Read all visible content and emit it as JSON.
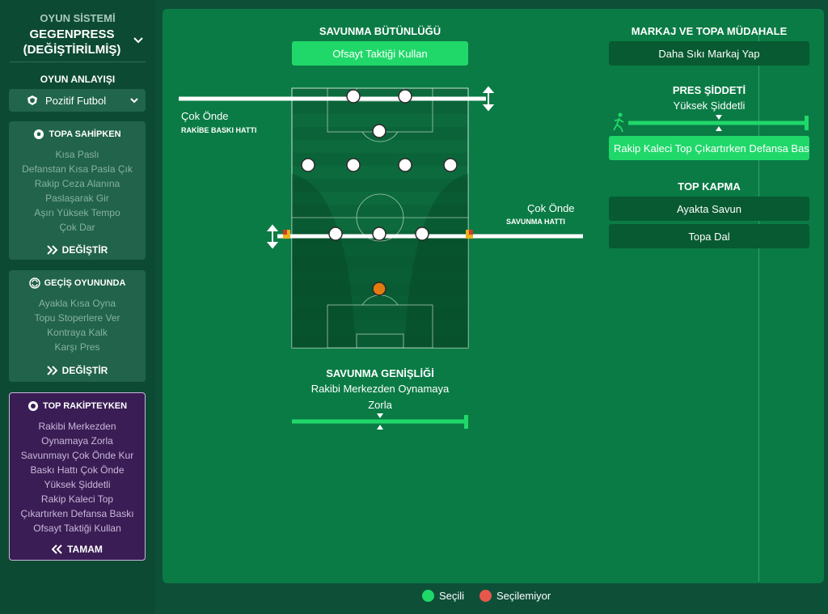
{
  "colors": {
    "accent_green": "#20d86a",
    "unavailable_red": "#e8574b",
    "ball_orange": "#e07b10",
    "purple_card": "#3a1d55",
    "line_yellow": "#e9b21a"
  },
  "system": {
    "label": "OYUN SİSTEMİ",
    "name_line1": "GEGENPRESS",
    "name_line2": "(DEĞİŞTİRİLMİŞ)"
  },
  "mentality": {
    "label": "OYUN ANLAYIŞI",
    "value": "Pozitif Futbol",
    "icon": "shield-icon"
  },
  "in_possession": {
    "title": "TOPA SAHİPKEN",
    "icon": "ball-icon",
    "items": [
      "Kısa Paslı",
      "Defanstan Kısa Pasla Çık",
      "Rakip Ceza Alanına",
      "Paslaşarak Gir",
      "Aşırı Yüksek Tempo",
      "Çok Dar"
    ],
    "action": "DEĞİŞTİR"
  },
  "transition": {
    "title": "GEÇİŞ OYUNUNDA",
    "icon": "cycle-icon",
    "items": [
      "Ayakla Kısa Oyna",
      "Topu Stoperlere Ver",
      "Kontraya Kalk",
      "Karşı Pres"
    ],
    "action": "DEĞİŞTİR"
  },
  "out_possession": {
    "title": "TOP RAKİPTEYKEN",
    "icon": "defense-icon",
    "items": [
      "Rakibi Merkezden",
      "Oynamaya Zorla",
      "Savunmayı Çok Önde Kur",
      "Baskı Hattı Çok Önde",
      "Yüksek Şiddetli",
      "Rakip Kaleci Top",
      "Çıkartırken Defansa Baskı",
      "Ofsayt Taktiği Kullan"
    ],
    "action": "TAMAM"
  },
  "defensive_shape": {
    "title": "SAVUNMA BÜTÜNLÜĞÜ",
    "offside_button": "Ofsayt Taktiği Kullan",
    "engagement_value": "Çok Önde",
    "engagement_label": "RAKİBE BASKI HATTI",
    "defline_value": "Çok Önde",
    "defline_label": "SAVUNMA HATTI"
  },
  "defensive_width": {
    "title": "SAVUNMA GENİŞLİĞİ",
    "value_line1": "Rakibi Merkezden Oynamaya",
    "value_line2": "Zorla",
    "slider_level": 0.5
  },
  "marking": {
    "title": "MARKAJ VE TOPA MÜDAHALE",
    "button": "Daha Sıkı Markaj Yap"
  },
  "pressing": {
    "title": "PRES ŞİDDETİ",
    "value": "Yüksek Şiddetli",
    "slider_level": 0.5,
    "goalkeeper_button": "Rakip Kaleci Top Çıkartırken Defansa Baskı"
  },
  "tackling": {
    "title": "TOP KAPMA",
    "options": [
      "Ayakta Savun",
      "Topa Dal"
    ]
  },
  "legend": {
    "selected": "Seçili",
    "unavailable": "Seçilemiyor"
  }
}
